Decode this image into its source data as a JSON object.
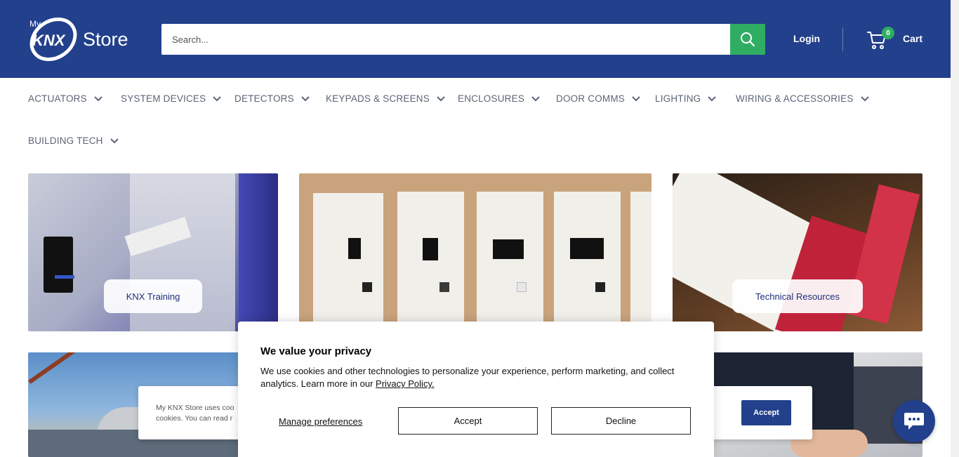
{
  "header": {
    "logo": {
      "text_top": "My",
      "text_mark": "KNX",
      "text_word": "Store"
    },
    "search": {
      "placeholder": "Search..."
    },
    "login_label": "Login",
    "cart": {
      "count": "0",
      "label": "Cart"
    }
  },
  "nav": {
    "items": [
      {
        "label": "ACTUATORS"
      },
      {
        "label": "SYSTEM DEVICES"
      },
      {
        "label": "DETECTORS"
      },
      {
        "label": "KEYPADS & SCREENS"
      },
      {
        "label": "ENCLOSURES"
      },
      {
        "label": "DOOR COMMS"
      },
      {
        "label": "LIGHTING"
      },
      {
        "label": "WIRING & ACCESSORIES"
      },
      {
        "label": "BUILDING TECH"
      }
    ]
  },
  "tiles": [
    {
      "label": "KNX Training"
    },
    {
      "label": ""
    },
    {
      "label": "Technical Resources"
    }
  ],
  "shop_banner": {
    "text_line1": "My KNX Store uses coo",
    "text_line2": "cookies. You can read r",
    "accept_label": "Accept"
  },
  "privacy_modal": {
    "title": "We value your privacy",
    "body": "We use cookies and other technologies to personalize your experience, perform marketing, and collect analytics. Learn more in our ",
    "link": "Privacy Policy.",
    "manage_label": "Manage preferences",
    "accept_label": "Accept",
    "decline_label": "Decline"
  },
  "colors": {
    "brand_blue": "#22408b",
    "accent_green": "#2fae63"
  },
  "icons": [
    "search-icon",
    "cart-icon",
    "chevron-down-icon",
    "chat-icon"
  ]
}
